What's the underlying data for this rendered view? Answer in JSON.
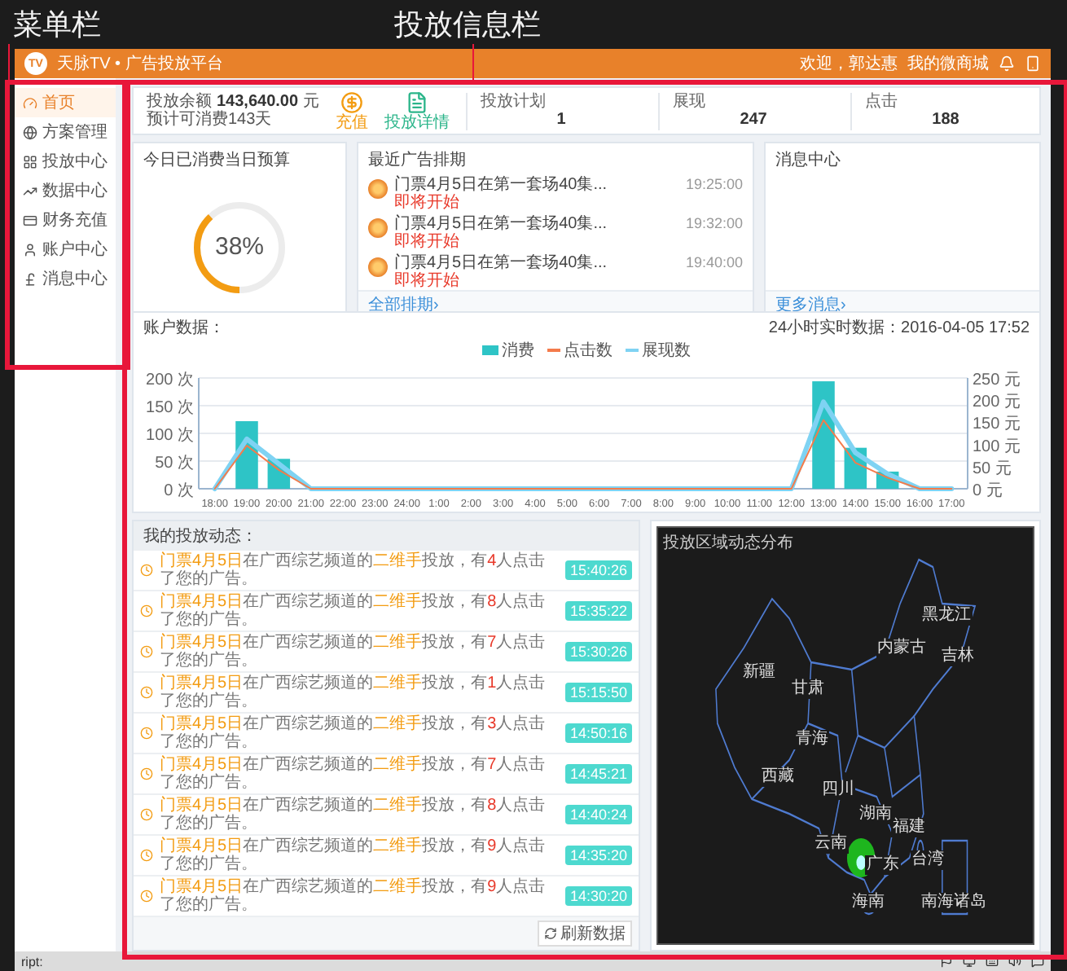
{
  "annotations": [
    {
      "text": "菜单栏"
    },
    {
      "text": "投放信息栏"
    }
  ],
  "header": {
    "logo": "TV",
    "title": "天脉TV • 广告投放平台",
    "welcome": "欢迎，郭达惠",
    "shop_link": "我的微商城"
  },
  "sidebar": {
    "items": [
      {
        "label": "首页",
        "selected": true
      },
      {
        "label": "方案管理",
        "selected": false
      },
      {
        "label": "投放中心",
        "selected": false
      },
      {
        "label": "数据中心",
        "selected": false
      },
      {
        "label": "财务充值",
        "selected": false
      },
      {
        "label": "账户中心",
        "selected": false
      },
      {
        "label": "消息中心",
        "selected": false
      }
    ]
  },
  "summary": {
    "balance_label": "投放余额",
    "balance": "143,640.00",
    "unit": "元",
    "forecast": "预计可消费143天",
    "actions": [
      {
        "label": "充值",
        "kind": "recharge"
      },
      {
        "label": "投放详情",
        "kind": "details"
      }
    ],
    "stats": [
      {
        "label": "投放计划",
        "value": "1"
      },
      {
        "label": "展现",
        "value": "247"
      },
      {
        "label": "点击",
        "value": "188"
      }
    ]
  },
  "budget": {
    "title": "今日已消费当日预算",
    "level": 0.38,
    "reading": "38%"
  },
  "schedule": {
    "title": "最近广告排期",
    "items": [
      {
        "title": "门票4月5日在第一套场40集...",
        "status": "即将开始",
        "time": "19:25:00"
      },
      {
        "title": "门票4月5日在第一套场40集...",
        "status": "即将开始",
        "time": "19:32:00"
      },
      {
        "title": "门票4月5日在第一套场40集...",
        "status": "即将开始",
        "time": "19:40:00"
      }
    ],
    "footer_link": "全部排期›"
  },
  "messages": {
    "title": "消息中心",
    "footer_link": "更多消息›"
  },
  "account_chart": {
    "title": "账户数据：",
    "realtime": "24小时实时数据：2016-04-05 17:52",
    "chart_data": {
      "type": "bar",
      "categories": [
        "18:00",
        "19:00",
        "20:00",
        "21:00",
        "22:00",
        "23:00",
        "24:00",
        "1:00",
        "2:00",
        "3:00",
        "4:00",
        "5:00",
        "6:00",
        "7:00",
        "8:00",
        "9:00",
        "10:00",
        "11:00",
        "12:00",
        "13:00",
        "14:00",
        "15:00",
        "16:00",
        "17:00"
      ],
      "series": [
        {
          "name": "消费",
          "type": "bar",
          "color": "#2ec4c6",
          "values": [
            0,
            122,
            54,
            0,
            0,
            0,
            0,
            0,
            0,
            0,
            0,
            0,
            0,
            0,
            0,
            0,
            0,
            0,
            0,
            194,
            74,
            31,
            0,
            0
          ]
        },
        {
          "name": "点击数",
          "type": "line",
          "color": "#f47b4b",
          "values": [
            0,
            78,
            34,
            0,
            0,
            0,
            0,
            0,
            0,
            0,
            0,
            0,
            0,
            0,
            0,
            0,
            0,
            0,
            0,
            124,
            47,
            20,
            0,
            0
          ]
        },
        {
          "name": "展现数",
          "type": "line",
          "color": "#7fd3f3",
          "values": [
            0,
            90,
            45,
            0,
            0,
            0,
            0,
            0,
            0,
            0,
            0,
            0,
            0,
            0,
            0,
            0,
            0,
            0,
            0,
            157,
            65,
            27,
            0,
            0
          ]
        }
      ],
      "ylim": [
        0,
        200
      ],
      "y2lim": [
        0,
        250
      ],
      "grid": true,
      "yticks": [
        {
          "value": 0,
          "label": "0 次"
        },
        {
          "value": 50,
          "label": "50 次"
        },
        {
          "value": 100,
          "label": "100 次"
        },
        {
          "value": 150,
          "label": "150 次"
        },
        {
          "value": 200,
          "label": "200 次"
        }
      ],
      "y2ticks": [
        {
          "value": 0,
          "label": "0 元"
        },
        {
          "value": 50,
          "label": "50 元"
        },
        {
          "value": 100,
          "label": "100 元"
        },
        {
          "value": 150,
          "label": "150 元"
        },
        {
          "value": 200,
          "label": "200 元"
        },
        {
          "value": 250,
          "label": "250 元"
        }
      ]
    }
  },
  "activity": {
    "title": "我的投放动态：",
    "rows": [
      {
        "segments": [
          {
            "text": "门票4月5日",
            "kind": "accent"
          },
          {
            "text": "在广西综艺频道的",
            "kind": "plain"
          },
          {
            "text": "二维手",
            "kind": "accent"
          },
          {
            "text": "投放，有",
            "kind": "plain"
          },
          {
            "text": "4",
            "kind": "count"
          },
          {
            "text": "人点击了您的广告。",
            "kind": "plain"
          }
        ],
        "time": "15:40:26"
      },
      {
        "segments": [
          {
            "text": "门票4月5日",
            "kind": "accent"
          },
          {
            "text": "在广西综艺频道的",
            "kind": "plain"
          },
          {
            "text": "二维手",
            "kind": "accent"
          },
          {
            "text": "投放，有",
            "kind": "plain"
          },
          {
            "text": "8",
            "kind": "count"
          },
          {
            "text": "人点击了您的广告。",
            "kind": "plain"
          }
        ],
        "time": "15:35:22"
      },
      {
        "segments": [
          {
            "text": "门票4月5日",
            "kind": "accent"
          },
          {
            "text": "在广西综艺频道的",
            "kind": "plain"
          },
          {
            "text": "二维手",
            "kind": "accent"
          },
          {
            "text": "投放，有",
            "kind": "plain"
          },
          {
            "text": "7",
            "kind": "count"
          },
          {
            "text": "人点击了您的广告。",
            "kind": "plain"
          }
        ],
        "time": "15:30:26"
      },
      {
        "segments": [
          {
            "text": "门票4月5日",
            "kind": "accent"
          },
          {
            "text": "在广西综艺频道的",
            "kind": "plain"
          },
          {
            "text": "二维手",
            "kind": "accent"
          },
          {
            "text": "投放，有",
            "kind": "plain"
          },
          {
            "text": "1",
            "kind": "count"
          },
          {
            "text": "人点击了您的广告。",
            "kind": "plain"
          }
        ],
        "time": "15:15:50"
      },
      {
        "segments": [
          {
            "text": "门票4月5日",
            "kind": "accent"
          },
          {
            "text": "在广西综艺频道的",
            "kind": "plain"
          },
          {
            "text": "二维手",
            "kind": "accent"
          },
          {
            "text": "投放，有",
            "kind": "plain"
          },
          {
            "text": "3",
            "kind": "count"
          },
          {
            "text": "人点击了您的广告。",
            "kind": "plain"
          }
        ],
        "time": "14:50:16"
      },
      {
        "segments": [
          {
            "text": "门票4月5日",
            "kind": "accent"
          },
          {
            "text": "在广西综艺频道的",
            "kind": "plain"
          },
          {
            "text": "二维手",
            "kind": "accent"
          },
          {
            "text": "投放，有",
            "kind": "plain"
          },
          {
            "text": "7",
            "kind": "count"
          },
          {
            "text": "人点击了您的广告。",
            "kind": "plain"
          }
        ],
        "time": "14:45:21"
      },
      {
        "segments": [
          {
            "text": "门票4月5日",
            "kind": "accent"
          },
          {
            "text": "在广西综艺频道的",
            "kind": "plain"
          },
          {
            "text": "二维手",
            "kind": "accent"
          },
          {
            "text": "投放，有",
            "kind": "plain"
          },
          {
            "text": "8",
            "kind": "count"
          },
          {
            "text": "人点击了您的广告。",
            "kind": "plain"
          }
        ],
        "time": "14:40:24"
      },
      {
        "segments": [
          {
            "text": "门票4月5日",
            "kind": "accent"
          },
          {
            "text": "在广西综艺频道的",
            "kind": "plain"
          },
          {
            "text": "二维手",
            "kind": "accent"
          },
          {
            "text": "投放，有",
            "kind": "plain"
          },
          {
            "text": "9",
            "kind": "count"
          },
          {
            "text": "人点击了您的广告。",
            "kind": "plain"
          }
        ],
        "time": "14:35:20"
      },
      {
        "segments": [
          {
            "text": "门票4月5日",
            "kind": "accent"
          },
          {
            "text": "在广西综艺频道的",
            "kind": "plain"
          },
          {
            "text": "二维手",
            "kind": "accent"
          },
          {
            "text": "投放，有",
            "kind": "plain"
          },
          {
            "text": "9",
            "kind": "count"
          },
          {
            "text": "人点击了您的广告。",
            "kind": "plain"
          }
        ],
        "time": "14:30:20"
      }
    ],
    "refresh_button": "刷新数据"
  },
  "map": {
    "title": "投放区域动态分布",
    "labels": [
      "新疆",
      "西藏",
      "青海",
      "甘肃",
      "内蒙古",
      "黑龙江",
      "吉林",
      "四川",
      "云南",
      "湖南",
      "福建",
      "广东",
      "台湾",
      "海南",
      "南海诸岛"
    ]
  },
  "status_bar": {
    "text": "ript:"
  }
}
